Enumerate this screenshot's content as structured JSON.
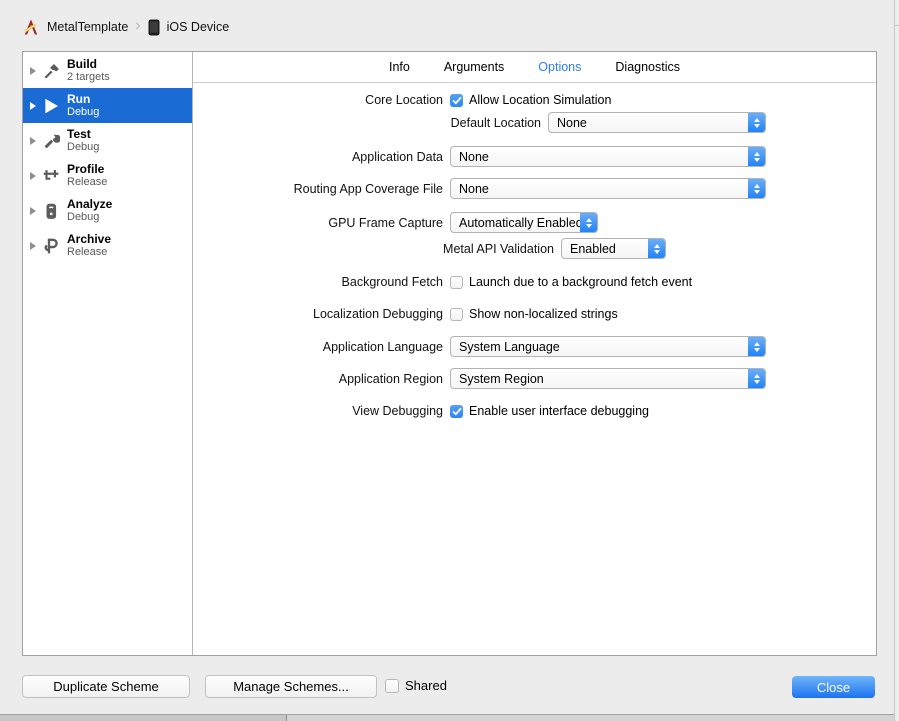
{
  "titlebar": {
    "project": "MetalTemplate",
    "separator": "›",
    "device": "iOS Device"
  },
  "sidebar": {
    "items": [
      {
        "title": "Build",
        "subtitle": "2 targets",
        "icon": "hammer-icon",
        "selected": false
      },
      {
        "title": "Run",
        "subtitle": "Debug",
        "icon": "play-icon",
        "selected": true
      },
      {
        "title": "Test",
        "subtitle": "Debug",
        "icon": "wrench-icon",
        "selected": false
      },
      {
        "title": "Profile",
        "subtitle": "Release",
        "icon": "gauge-icon",
        "selected": false
      },
      {
        "title": "Analyze",
        "subtitle": "Debug",
        "icon": "analyze-icon",
        "selected": false
      },
      {
        "title": "Archive",
        "subtitle": "Release",
        "icon": "archive-icon",
        "selected": false
      }
    ]
  },
  "tabs": {
    "items": [
      {
        "label": "Info",
        "selected": false
      },
      {
        "label": "Arguments",
        "selected": false
      },
      {
        "label": "Options",
        "selected": true
      },
      {
        "label": "Diagnostics",
        "selected": false
      }
    ]
  },
  "form": {
    "core_location": {
      "label": "Core Location",
      "checkbox_label": "Allow Location Simulation",
      "checked": true
    },
    "default_location": {
      "label": "Default Location",
      "value": "None"
    },
    "application_data": {
      "label": "Application Data",
      "value": "None"
    },
    "routing_app_coverage_file": {
      "label": "Routing App Coverage File",
      "value": "None"
    },
    "gpu_frame_capture": {
      "label": "GPU Frame Capture",
      "value": "Automatically Enabled"
    },
    "metal_api_validation": {
      "label": "Metal API Validation",
      "value": "Enabled"
    },
    "background_fetch": {
      "label": "Background Fetch",
      "checkbox_label": "Launch due to a background fetch event",
      "checked": false
    },
    "localization_debugging": {
      "label": "Localization Debugging",
      "checkbox_label": "Show non-localized strings",
      "checked": false
    },
    "application_language": {
      "label": "Application Language",
      "value": "System Language"
    },
    "application_region": {
      "label": "Application Region",
      "value": "System Region"
    },
    "view_debugging": {
      "label": "View Debugging",
      "checkbox_label": "Enable user interface debugging",
      "checked": true
    }
  },
  "footer": {
    "duplicate_label": "Duplicate Scheme",
    "manage_label": "Manage Schemes...",
    "shared_label": "Shared",
    "shared_checked": false,
    "close_label": "Close"
  },
  "colors": {
    "window_bg": "#ececec",
    "selection_blue": "#1a6bd4",
    "tab_active_blue": "#2d7ef7",
    "control_blue": "#2183f8",
    "close_button_blue": "#1d73f0"
  }
}
